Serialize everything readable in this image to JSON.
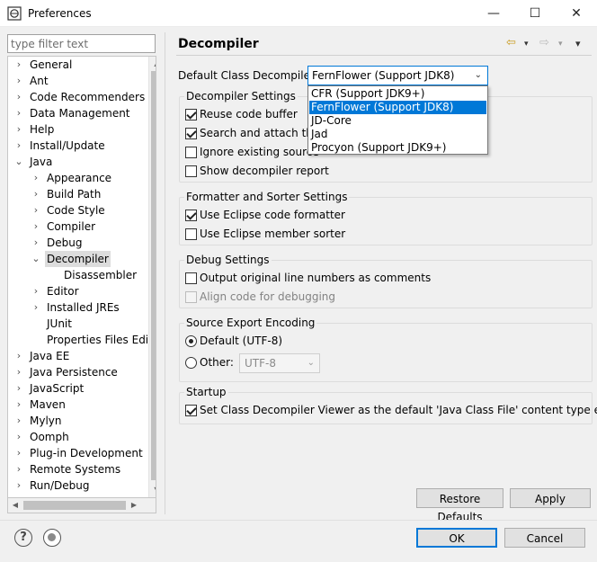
{
  "window": {
    "title": "Preferences",
    "minimize": "—",
    "maximize": "☐",
    "close": "✕"
  },
  "filter": {
    "placeholder": "type filter text"
  },
  "tree": {
    "items": [
      {
        "label": "General",
        "level": 0,
        "arrow": "›"
      },
      {
        "label": "Ant",
        "level": 0,
        "arrow": "›"
      },
      {
        "label": "Code Recommenders",
        "level": 0,
        "arrow": "›"
      },
      {
        "label": "Data Management",
        "level": 0,
        "arrow": "›"
      },
      {
        "label": "Help",
        "level": 0,
        "arrow": "›"
      },
      {
        "label": "Install/Update",
        "level": 0,
        "arrow": "›"
      },
      {
        "label": "Java",
        "level": 0,
        "arrow": "⌄"
      },
      {
        "label": "Appearance",
        "level": 1,
        "arrow": "›"
      },
      {
        "label": "Build Path",
        "level": 1,
        "arrow": "›"
      },
      {
        "label": "Code Style",
        "level": 1,
        "arrow": "›"
      },
      {
        "label": "Compiler",
        "level": 1,
        "arrow": "›"
      },
      {
        "label": "Debug",
        "level": 1,
        "arrow": "›"
      },
      {
        "label": "Decompiler",
        "level": 1,
        "arrow": "⌄",
        "selected": true
      },
      {
        "label": "Disassembler",
        "level": 2,
        "arrow": ""
      },
      {
        "label": "Editor",
        "level": 1,
        "arrow": "›"
      },
      {
        "label": "Installed JREs",
        "level": 1,
        "arrow": "›"
      },
      {
        "label": "JUnit",
        "level": 1,
        "arrow": ""
      },
      {
        "label": "Properties Files Edito",
        "level": 1,
        "arrow": ""
      },
      {
        "label": "Java EE",
        "level": 0,
        "arrow": "›"
      },
      {
        "label": "Java Persistence",
        "level": 0,
        "arrow": "›"
      },
      {
        "label": "JavaScript",
        "level": 0,
        "arrow": "›"
      },
      {
        "label": "Maven",
        "level": 0,
        "arrow": "›"
      },
      {
        "label": "Mylyn",
        "level": 0,
        "arrow": "›"
      },
      {
        "label": "Oomph",
        "level": 0,
        "arrow": "›"
      },
      {
        "label": "Plug-in Development",
        "level": 0,
        "arrow": "›"
      },
      {
        "label": "Remote Systems",
        "level": 0,
        "arrow": "›"
      },
      {
        "label": "Run/Debug",
        "level": 0,
        "arrow": "›"
      }
    ]
  },
  "page": {
    "title": "Decompiler",
    "back_icon": "⇦",
    "forward_icon": "⇨",
    "menu_icon": "▾"
  },
  "default_decompiler": {
    "label": "Default Class Decompiler",
    "value": "FernFlower (Support JDK8)",
    "options": [
      "CFR (Support JDK9+)",
      "FernFlower (Support JDK8)",
      "JD-Core",
      "Jad",
      "Procyon (Support JDK9+)"
    ]
  },
  "decompiler_settings": {
    "title": "Decompiler Settings",
    "reuse_buffer": "Reuse code buffer",
    "search_attach": "Search and attach the",
    "ignore_existing": "Ignore existing source",
    "show_report": "Show decompiler report"
  },
  "formatter": {
    "title": "Formatter and Sorter Settings",
    "use_formatter": "Use Eclipse code formatter",
    "use_sorter": "Use Eclipse member sorter"
  },
  "debug": {
    "title": "Debug Settings",
    "line_numbers": "Output original line numbers as comments",
    "align_code": "Align code for debugging"
  },
  "encoding": {
    "title": "Source Export Encoding",
    "default_label": "Default (UTF-8)",
    "other_label": "Other:",
    "other_value": "UTF-8"
  },
  "startup": {
    "title": "Startup",
    "set_default": "Set Class Decompiler Viewer as the default 'Java Class File' content type editor"
  },
  "buttons": {
    "restore": "Restore Defaults",
    "apply": "Apply",
    "ok": "OK",
    "cancel": "Cancel"
  },
  "help": {
    "glyph": "?"
  }
}
